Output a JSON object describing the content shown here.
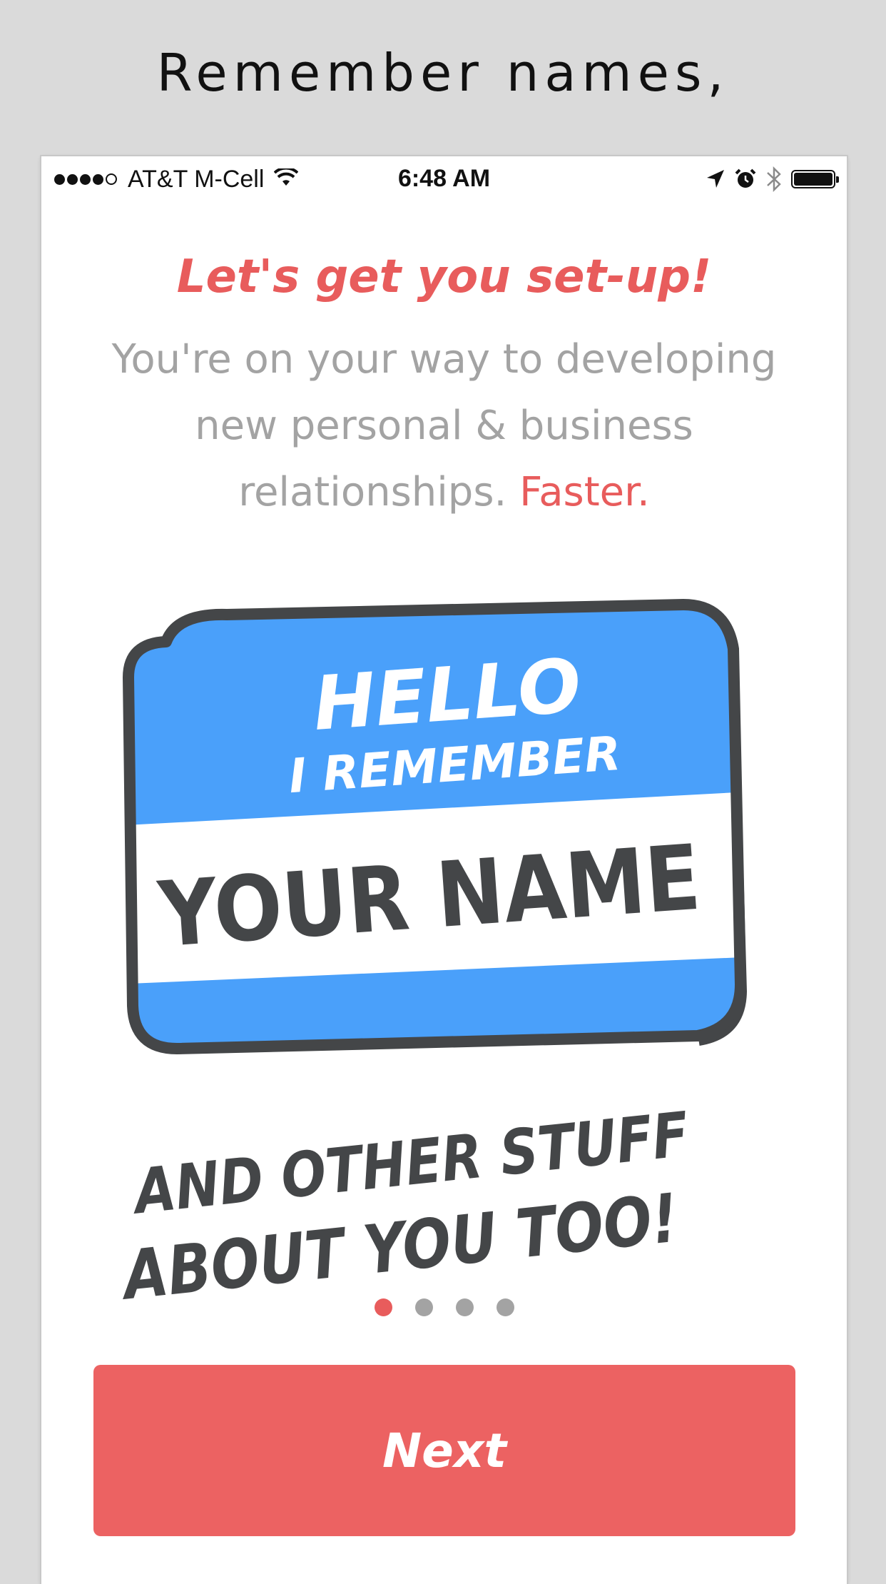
{
  "headline": "Remember names,",
  "status_bar": {
    "signal_icon": "signal-dots-icon",
    "carrier": "AT&T M-Cell",
    "time": "6:48 AM"
  },
  "screen": {
    "title": "Let's get you set-up!",
    "subtitle_main": "You're on your way to developing new personal & business relationships.",
    "subtitle_accent": "Faster."
  },
  "illustration": {
    "badge_line1": "HELLO",
    "badge_line2": "I REMEMBER",
    "badge_name": "YOUR NAME",
    "caption_line1": "AND OTHER STUFF",
    "caption_line2": "ABOUT YOU TOO!"
  },
  "pager": {
    "total": 4,
    "active_index": 0
  },
  "next_button": {
    "label": "Next"
  },
  "colors": {
    "accent": "#e85c5c",
    "badge_blue": "#4aa0fa",
    "ink": "#444648"
  }
}
